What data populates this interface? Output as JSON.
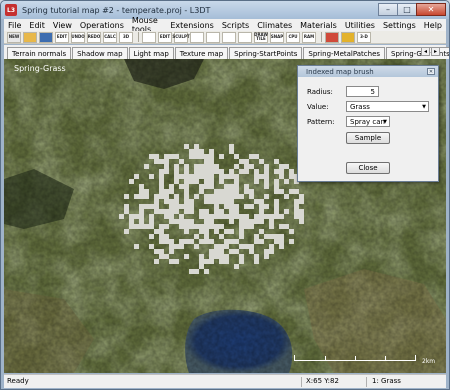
{
  "window": {
    "title": "Spring tutorial map #2 - temperate.proj - L3DT",
    "app_icon_text": "L3",
    "controls": {
      "minimize": "–",
      "maximize": "□",
      "close": "✕"
    }
  },
  "menu": [
    "File",
    "Edit",
    "View",
    "Operations",
    "Mouse tools",
    "Extensions",
    "Scripts",
    "Climates",
    "Materials",
    "Utilities",
    "Settings",
    "Help"
  ],
  "toolbar": [
    {
      "name": "new",
      "label": "NEW",
      "color": "#e8e8e8"
    },
    {
      "name": "open",
      "label": "",
      "color": "#e8b84a"
    },
    {
      "name": "save",
      "label": "",
      "color": "#3d6db0"
    },
    {
      "name": "edit",
      "label": "EDIT",
      "color": "#ffffff"
    },
    {
      "name": "undo",
      "label": "UNDO",
      "color": "#ffffff"
    },
    {
      "name": "redo",
      "label": "REDO",
      "color": "#ffffff"
    },
    {
      "name": "calc",
      "label": "CALC",
      "color": "#ffffff"
    },
    {
      "name": "view3d",
      "label": "3D",
      "color": "#ffffff"
    },
    {
      "name": "sep1",
      "sep": true
    },
    {
      "name": "select",
      "label": "",
      "color": "#ffffff"
    },
    {
      "name": "edit-tool",
      "label": "EDIT",
      "color": "#ffffff"
    },
    {
      "name": "sculpt",
      "label": "SCULPT",
      "color": "#ffffff"
    },
    {
      "name": "tool-a",
      "label": "",
      "color": "#ffffff"
    },
    {
      "name": "tool-b",
      "label": "",
      "color": "#ffffff"
    },
    {
      "name": "tool-c",
      "label": "",
      "color": "#ffffff"
    },
    {
      "name": "tool-d",
      "label": "",
      "color": "#ffffff"
    },
    {
      "name": "draw-tile",
      "label": "DRAW TILE",
      "color": "#ffffff"
    },
    {
      "name": "snap",
      "label": "SNAP",
      "color": "#ffffff"
    },
    {
      "name": "cpu",
      "label": "CPU",
      "color": "#ffffff"
    },
    {
      "name": "ram",
      "label": "RAM",
      "color": "#ffffff"
    },
    {
      "name": "sep2",
      "sep": true
    },
    {
      "name": "brush",
      "label": "",
      "color": "#d04a3a",
      "active": true
    },
    {
      "name": "warning",
      "label": "",
      "color": "#e3b22b"
    },
    {
      "name": "view-3d",
      "label": "3-D",
      "color": "#ffffff"
    }
  ],
  "tabs": [
    {
      "label": "Terrain normals",
      "active": false
    },
    {
      "label": "Shadow map",
      "active": false
    },
    {
      "label": "Light map",
      "active": false
    },
    {
      "label": "Texture map",
      "active": false
    },
    {
      "label": "Spring-StartPoints",
      "active": false
    },
    {
      "label": "Spring-MetalPatches",
      "active": false
    },
    {
      "label": "Spring-Geovents",
      "active": false
    },
    {
      "label": "Spring-Features",
      "active": true
    }
  ],
  "map": {
    "label": "Spring-Grass",
    "scale_text": "2km"
  },
  "dialog": {
    "title": "Indexed map brush",
    "radius_label": "Radius:",
    "radius_value": "5",
    "value_label": "Value:",
    "value_selected": "Grass",
    "pattern_label": "Pattern:",
    "pattern_selected": "Spray can",
    "sample_button": "Sample",
    "close_button": "Close"
  },
  "status": {
    "text": "Ready",
    "coords": "X:65 Y:82",
    "value": "1: Grass"
  }
}
